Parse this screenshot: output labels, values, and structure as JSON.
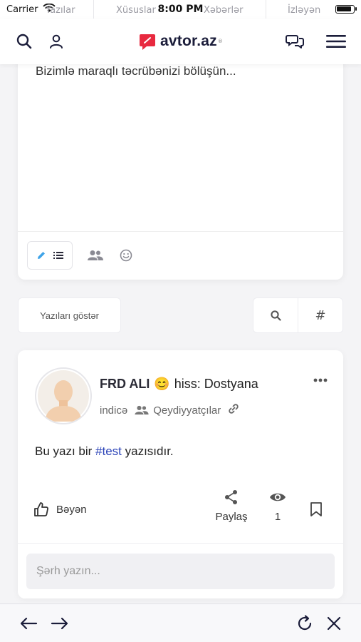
{
  "status": {
    "carrier": "Carrier",
    "time": "8:00 PM",
    "ghost_tabs": [
      "Yazılar",
      "Xüsuslar",
      "Xəbərlər",
      "İzləyən"
    ]
  },
  "header": {
    "logo_text": "avtor.az",
    "logo_reg": "®",
    "brand_color": "#e8293f"
  },
  "composer": {
    "placeholder": "Bizimlə maraqlı təcrübənizi bölüşün..."
  },
  "filters": {
    "show_posts": "Yazıları göstər",
    "hash_symbol": "#"
  },
  "post": {
    "author": "FRD ALI",
    "feeling": "hiss: Dostyana",
    "time": "indicə",
    "audience": "Qeydiyyatçılar",
    "content_prefix": "Bu yazı bir ",
    "hashtag": "#test",
    "content_suffix": " yazısıdır.",
    "like_label": "Bəyən",
    "share_label": "Paylaş",
    "views_count": "1",
    "comment_placeholder": "Şərh yazın..."
  },
  "colors": {
    "accent_blue": "#2b43b8",
    "icon_navy": "#1b1d3a"
  }
}
